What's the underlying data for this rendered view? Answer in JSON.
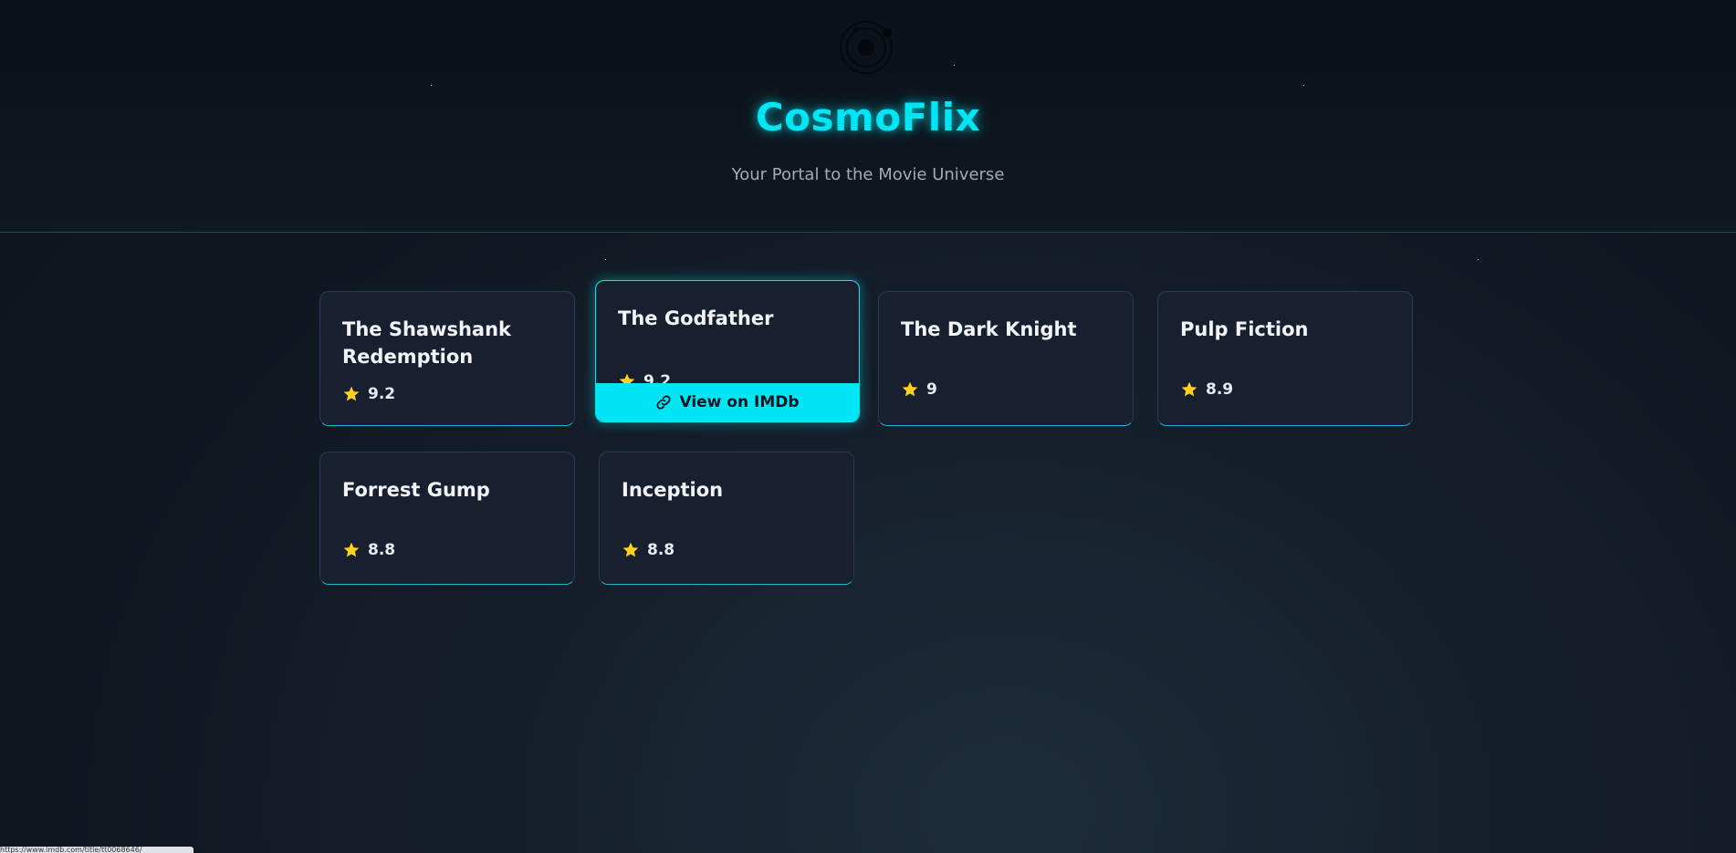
{
  "header": {
    "logo_icon": "orbit-logo-icon",
    "title": "CosmoFlix",
    "tagline": "Your Portal to the Movie Universe"
  },
  "colors": {
    "accent": "#00e6f5",
    "card_bg": "#182030",
    "star": "#ffd21f"
  },
  "movies": [
    {
      "title": "The Shawshank Redemption",
      "rating": "9.2"
    },
    {
      "title": "The Godfather",
      "rating": "9.2",
      "link_label": "View on IMDb",
      "link_icon": "link-icon"
    },
    {
      "title": "The Dark Knight",
      "rating": "9"
    },
    {
      "title": "Pulp Fiction",
      "rating": "8.9"
    },
    {
      "title": "Forrest Gump",
      "rating": "8.8"
    },
    {
      "title": "Inception",
      "rating": "8.8"
    }
  ],
  "rating_icon": "star-icon",
  "status_bar": {
    "url": "https://www.imdb.com/title/tt0068646/"
  }
}
